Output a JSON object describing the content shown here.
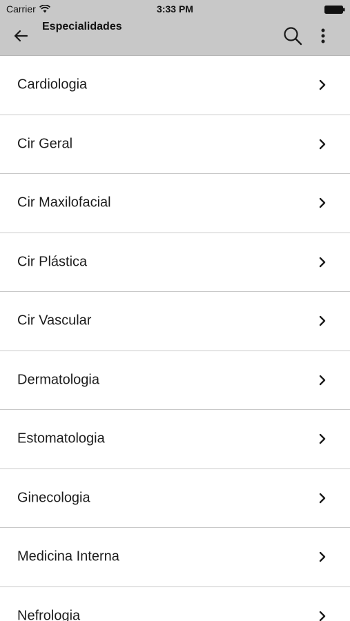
{
  "status_bar": {
    "carrier": "Carrier",
    "time": "3:33 PM"
  },
  "header": {
    "title": "Especialidades",
    "back_icon": "arrow-left-icon",
    "search_icon": "search-icon",
    "more_icon": "more-vertical-icon"
  },
  "colors": {
    "header_background": "#c8c8c8",
    "divider": "#c9c9c9"
  },
  "list": {
    "items": [
      {
        "label": "Cardiologia"
      },
      {
        "label": "Cir Geral"
      },
      {
        "label": "Cir Maxilofacial"
      },
      {
        "label": "Cir Plástica"
      },
      {
        "label": "Cir Vascular"
      },
      {
        "label": "Dermatologia"
      },
      {
        "label": "Estomatologia"
      },
      {
        "label": "Ginecologia"
      },
      {
        "label": "Medicina Interna"
      },
      {
        "label": "Nefrologia"
      }
    ]
  }
}
